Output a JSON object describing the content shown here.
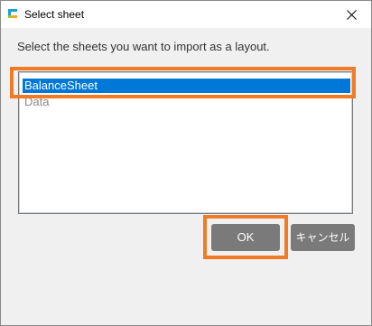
{
  "window": {
    "title": "Select sheet",
    "icon": "app-logo-icon",
    "close_icon": "close-icon",
    "accent_color": "#0078d7",
    "highlight_color": "#f07b24"
  },
  "dialog": {
    "instruction": "Select the sheets you want to import as a layout.",
    "sheets": [
      {
        "label": "BalanceSheet",
        "selected": true
      },
      {
        "label": "Data",
        "selected": false
      }
    ]
  },
  "buttons": {
    "ok_label": "OK",
    "cancel_label": "キャンセル"
  }
}
